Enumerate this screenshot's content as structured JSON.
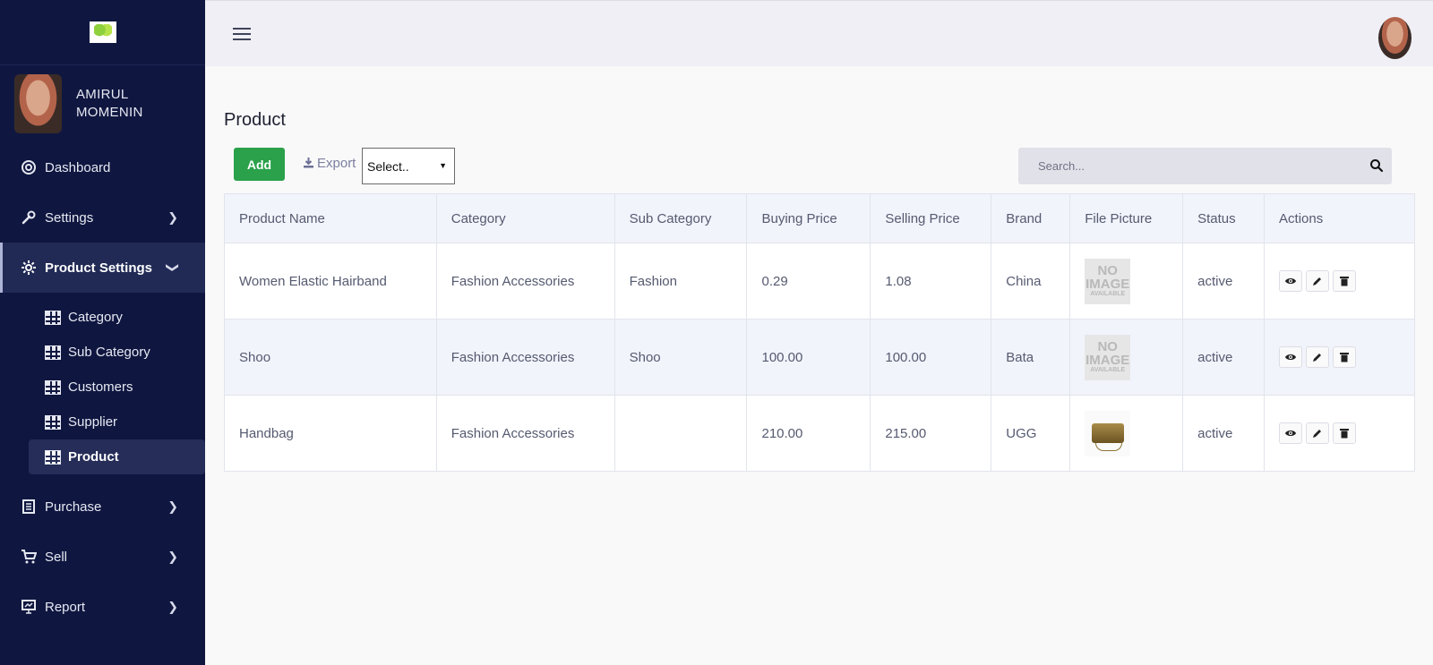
{
  "user": {
    "name_line1": "AMIRUL",
    "name_line2": "MOMENIN"
  },
  "sidebar": {
    "items": [
      {
        "label": "Dashboard",
        "icon": "dashboard-icon"
      },
      {
        "label": "Settings",
        "icon": "wrench-icon"
      },
      {
        "label": "Product Settings",
        "icon": "gear-icon"
      },
      {
        "label": "Purchase",
        "icon": "document-icon"
      },
      {
        "label": "Sell",
        "icon": "cart-icon"
      },
      {
        "label": "Report",
        "icon": "presentation-icon"
      }
    ],
    "submenu": [
      {
        "label": "Category"
      },
      {
        "label": "Sub Category"
      },
      {
        "label": "Customers"
      },
      {
        "label": "Supplier"
      },
      {
        "label": "Product"
      }
    ]
  },
  "page": {
    "title": "Product",
    "add_label": "Add",
    "export_label": "Export",
    "select_value": "Select..",
    "search_placeholder": "Search..."
  },
  "table": {
    "headers": [
      "Product Name",
      "Category",
      "Sub Category",
      "Buying Price",
      "Selling Price",
      "Brand",
      "File Picture",
      "Status",
      "Actions"
    ],
    "rows": [
      {
        "name": "Women Elastic Hairband",
        "category": "Fashion Accessories",
        "sub_category": "Fashion",
        "buying": "0.29",
        "selling": "1.08",
        "brand": "China",
        "picture": "no-image",
        "status": "active"
      },
      {
        "name": "Shoo",
        "category": "Fashion Accessories",
        "sub_category": "Shoo",
        "buying": "100.00",
        "selling": "100.00",
        "brand": "Bata",
        "picture": "no-image",
        "status": "active"
      },
      {
        "name": "Handbag",
        "category": "Fashion Accessories",
        "sub_category": "",
        "buying": "210.00",
        "selling": "215.00",
        "brand": "UGG",
        "picture": "handbag",
        "status": "active"
      }
    ],
    "no_image_text": {
      "line1": "NO",
      "line2": "IMAGE",
      "line3": "AVAILABLE"
    }
  },
  "colors": {
    "sidebar_bg": "#0f1740",
    "add_button": "#2aa14a",
    "topbar_bg": "#efeff5"
  }
}
